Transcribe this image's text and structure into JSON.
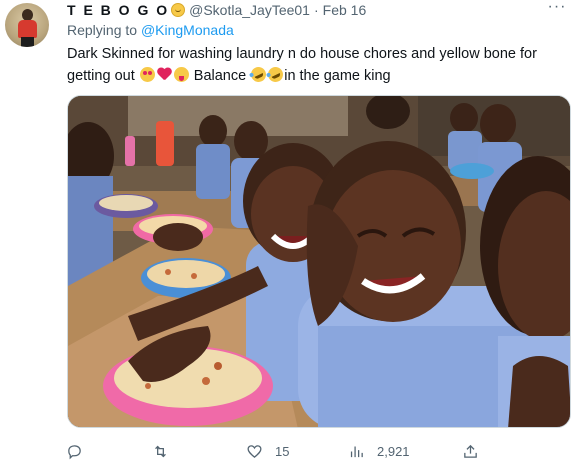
{
  "tweet": {
    "author": {
      "display_name": "T E B O G O",
      "name_emoji": "smiling-face-emoji",
      "handle": "@Skotla_JayTee01",
      "separator": "·",
      "date": "Feb 16"
    },
    "reply": {
      "prefix": "Replying to ",
      "mention": "@KingMonada"
    },
    "text": {
      "part1": "Dark Skinned for washing laundry n do house chores and yellow bone for getting out ",
      "part2": " Balance ",
      "part3": "in the game king"
    },
    "emojis": [
      "heart-eyes-emoji",
      "red-heart-emoji",
      "tongue-wink-emoji",
      "rofl-emoji",
      "rofl-emoji"
    ],
    "media": {
      "description_icon": "photo"
    },
    "actions": {
      "reply": {
        "icon": "reply-icon",
        "count": ""
      },
      "retweet": {
        "icon": "retweet-icon",
        "count": ""
      },
      "like": {
        "icon": "heart-icon",
        "count": "15"
      },
      "views": {
        "icon": "views-icon",
        "count": "2,921"
      },
      "share": {
        "icon": "share-icon",
        "count": ""
      }
    },
    "more_icon": "ellipsis-icon"
  },
  "colors": {
    "text": "#0f1419",
    "secondary": "#536471",
    "link": "#1d9bf0",
    "border": "#cfd9de"
  }
}
